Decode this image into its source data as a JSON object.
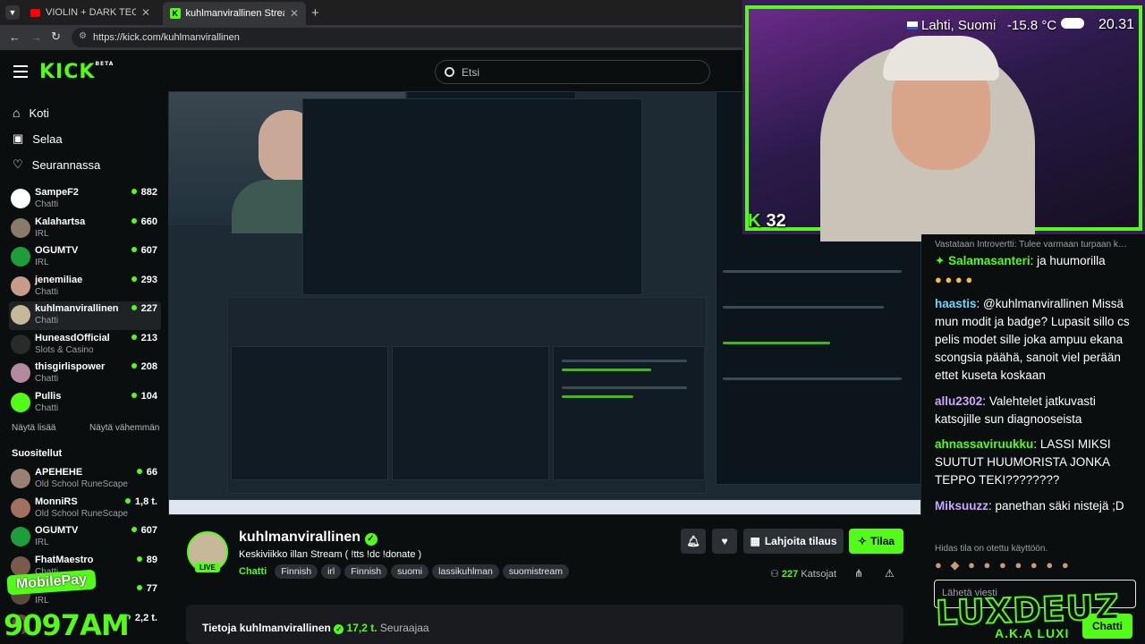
{
  "browser": {
    "tabs": [
      {
        "title": "VIOLIN + DARK TECHNO / …"
      },
      {
        "title": "kuhlmanvirallinen Stream - Wat…"
      }
    ],
    "url": "https://kick.com/kuhlmanvirallinen"
  },
  "header": {
    "logo": "KICK",
    "logo_sup": "BETA",
    "search_placeholder": "Etsi"
  },
  "nav": [
    {
      "label": "Koti"
    },
    {
      "label": "Selaa"
    },
    {
      "label": "Seurannassa"
    }
  ],
  "following": [
    {
      "name": "SampeF2",
      "category": "Chatti",
      "viewers": "882",
      "color": "#ffffff"
    },
    {
      "name": "Kalahartsa",
      "category": "IRL",
      "viewers": "660",
      "color": "#8a7a6a"
    },
    {
      "name": "OGUMTV",
      "category": "IRL",
      "viewers": "607",
      "color": "#1e9e3a"
    },
    {
      "name": "jenemiliae",
      "category": "Chatti",
      "viewers": "293",
      "color": "#c79a8a"
    },
    {
      "name": "kuhlmanvirallinen",
      "category": "Chatti",
      "viewers": "227",
      "color": "#c7b89a"
    },
    {
      "name": "HuneasdOfficial",
      "category": "Slots & Casino",
      "viewers": "213",
      "color": "#2a2a2a"
    },
    {
      "name": "thisgirlispower",
      "category": "Chatti",
      "viewers": "208",
      "color": "#b58aa0"
    },
    {
      "name": "Pullis",
      "category": "Chatti",
      "viewers": "104",
      "color": "#53fc18"
    }
  ],
  "show_more": "Näytä lisää",
  "show_less": "Näytä vähemmän",
  "recommended_title": "Suositellut",
  "recommended": [
    {
      "name": "APEHEHE",
      "category": "Old School RuneScape",
      "viewers": "66",
      "color": "#9a8070"
    },
    {
      "name": "MonniRS",
      "category": "Old School RuneScape",
      "viewers": "1,8 t.",
      "color": "#a07060"
    },
    {
      "name": "OGUMTV",
      "category": "IRL",
      "viewers": "607",
      "color": "#1e9e3a"
    },
    {
      "name": "FhatMaestro",
      "category": "Chatti",
      "viewers": "89",
      "color": "#7a5a4a"
    },
    {
      "name": "",
      "category": "IRL",
      "viewers": "77",
      "color": "#5a4a3a"
    },
    {
      "name": "",
      "category": "",
      "viewers": "2,2 t.",
      "color": "#6a4a3a"
    }
  ],
  "overlay_bottom_left": {
    "badge": "MobilePay",
    "number": "9097AM"
  },
  "stream": {
    "streamer": "kuhlmanvirallinen",
    "title": "Keskiviikko illan Stream ( !tts !dc !donate )",
    "category": "Chatti",
    "tags": [
      "Finnish",
      "irl",
      "Finnish",
      "suomi",
      "lassikuhlman",
      "suomistream"
    ],
    "live": "LIVE",
    "viewers": "227",
    "viewers_label": "Katsojat",
    "subscribe": "Lahjoita tilaus",
    "follow": "Tilaa",
    "about": "Tietoja kuhlmanvirallinen",
    "followers": "17,2 t.",
    "followers_label": "Seuraajaa"
  },
  "webcam": {
    "location": "Lahti, Suomi",
    "temp": "-15.8 °C",
    "time": "20.31",
    "kick_count": "32"
  },
  "chat": {
    "pinned": "Vastataan Introvertti: Tulee varmaan turpaan k…",
    "messages": [
      {
        "user": "Salamasanteri",
        "color": "#53fc18",
        "text": "ja huumorilla"
      },
      {
        "user": "haastis",
        "color": "#6bd6ff",
        "text": "@kuhlmanvirallinen Missä mun modit ja badge? Lupasit sillo cs pelis modet sille joka ampuu ekana scongsia päähä, sanoit viel perään ettet kuseta koskaan"
      },
      {
        "user": "allu2302",
        "color": "#c9a6ff",
        "text": "Valehtelet jatkuvasti katsojille sun diagnooseista"
      },
      {
        "user": "ahnassaviruukku",
        "color": "#53fc18",
        "text": "LASSI MIKSI SUUTUT HUUMORISTA JONKA TEPPO TEKI????????"
      },
      {
        "user": "Miksuuzz",
        "color": "#c9a6ff",
        "text": "panethan säki nistejä ;D"
      }
    ],
    "slow_mode": "Hidas tila on otettu käyttöön.",
    "input_placeholder": "Lähetä viesti",
    "send": "Chatti",
    "watermark": "LUXDEUZ",
    "watermark_sub": "A.K.A LUXI"
  }
}
